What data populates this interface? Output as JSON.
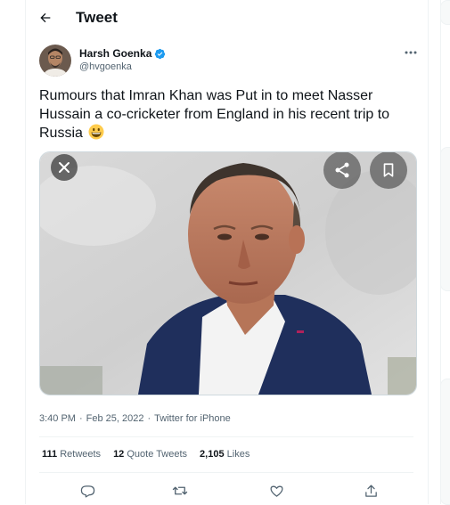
{
  "header": {
    "back_icon": "arrow-left-icon",
    "title": "Tweet"
  },
  "author": {
    "name": "Harsh Goenka",
    "handle": "@hvgoenka",
    "verified_icon": "verified-badge-icon",
    "verified_color": "#1d9bf0"
  },
  "tweet": {
    "text": "Rumours that Imran Khan was Put in to meet Nasser Hussain a co-cricketer from England in his recent trip to Russia",
    "emoji": "grinning-face-emoji"
  },
  "media": {
    "type": "photo",
    "buttons": [
      "close-icon",
      "share-icon",
      "bookmark-icon"
    ]
  },
  "meta": {
    "time": "3:40 PM",
    "date": "Feb 25, 2022",
    "separator": "·",
    "source": "Twitter for iPhone"
  },
  "stats": {
    "retweets_count": "111",
    "retweets_label": "Retweets",
    "quotes_count": "12",
    "quotes_label": "Quote Tweets",
    "likes_count": "2,105",
    "likes_label": "Likes"
  },
  "actions": [
    "reply-icon",
    "retweet-icon",
    "like-icon",
    "share-icon"
  ],
  "colors": {
    "text": "#0f1419",
    "secondary": "#536471",
    "border": "#eff3f4",
    "accent": "#1d9bf0"
  }
}
